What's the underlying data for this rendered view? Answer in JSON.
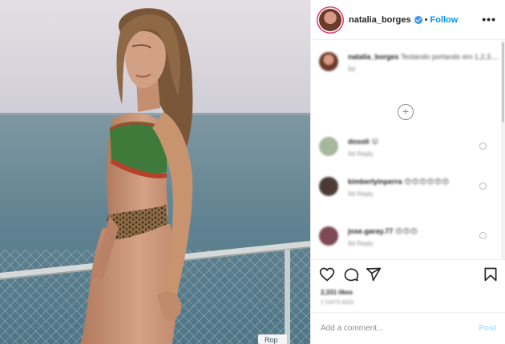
{
  "post": {
    "username": "natalia_borges",
    "follow_label": "Follow",
    "separator": "•",
    "more_glyph": "•••",
    "photo_sign": "Rop"
  },
  "caption": {
    "username": "natalia_borges",
    "text": "Testando portando em 1,2,3....",
    "time": "9d"
  },
  "comments": [
    {
      "username": "dosoli",
      "text": "😮",
      "meta": "9d Reply"
    },
    {
      "username": "kimberlyinperra",
      "text": "😍😍😍😍😍😍",
      "meta": "9d Reply"
    },
    {
      "username": "jose.garay.77",
      "text": "😍😍😍",
      "meta": "9d Reply"
    }
  ],
  "footer": {
    "likes": "2,331 likes",
    "age": "1 DAYS AGO",
    "comment_placeholder": "Add a comment...",
    "post_label": "Post"
  },
  "colors": {
    "accent": "#0095f6",
    "post_disabled": "#b2dffc",
    "story_ring": "#e1306c"
  },
  "icons": [
    "heart-icon",
    "comment-icon",
    "share-icon",
    "bookmark-icon",
    "plus-circle-icon",
    "verified-icon"
  ]
}
